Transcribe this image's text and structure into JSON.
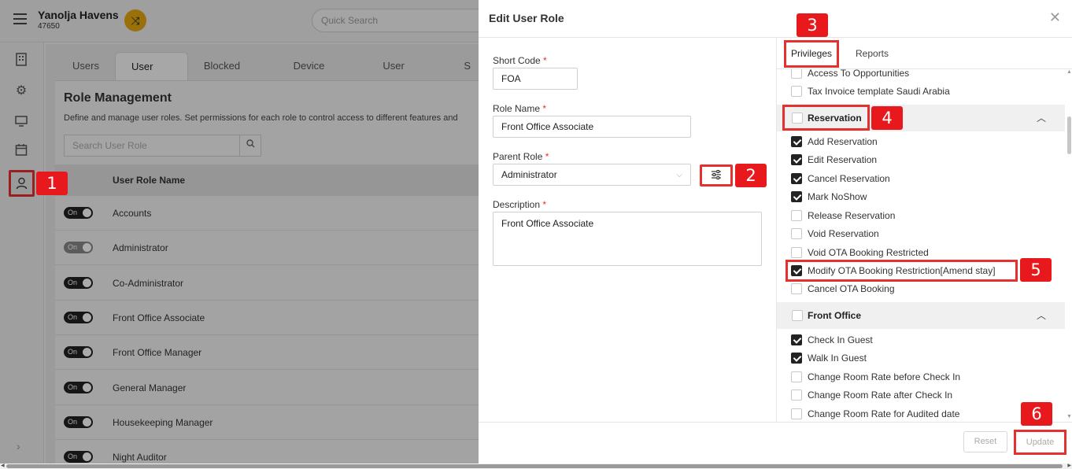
{
  "app": {
    "hotel_name": "Yanolja Havens",
    "hotel_id": "47650",
    "quick_search_placeholder": "Quick Search"
  },
  "tabs": [
    "Users",
    "User Role",
    "Blocked Users",
    "Device Activity",
    "User Activity",
    "S"
  ],
  "role_management": {
    "title": "Role Management",
    "description": "Define and manage user roles. Set permissions for each role to control access to different features and",
    "search_placeholder": "Search User Role",
    "column_header": "User Role Name",
    "rows": [
      {
        "status": "On",
        "name": "Accounts"
      },
      {
        "status": "On",
        "name": "Administrator"
      },
      {
        "status": "On",
        "name": "Co-Administrator"
      },
      {
        "status": "On",
        "name": "Front Office Associate"
      },
      {
        "status": "On",
        "name": "Front Office Manager"
      },
      {
        "status": "On",
        "name": "General Manager"
      },
      {
        "status": "On",
        "name": "Housekeeping Manager"
      },
      {
        "status": "On",
        "name": "Night Auditor"
      }
    ]
  },
  "drawer": {
    "title": "Edit User Role",
    "short_code_label": "Short Code",
    "short_code_value": "FOA",
    "role_name_label": "Role Name",
    "role_name_value": "Front Office Associate",
    "parent_role_label": "Parent Role",
    "parent_role_value": "Administrator",
    "description_label": "Description",
    "description_value": "Front Office Associate",
    "required_mark": "*",
    "tabs": {
      "privileges": "Privileges",
      "reports": "Reports"
    },
    "reset_label": "Reset",
    "update_label": "Update"
  },
  "privileges": {
    "top_items": [
      {
        "label": "Access To Opportunities",
        "checked": false
      },
      {
        "label": "Tax Invoice template Saudi Arabia",
        "checked": false
      }
    ],
    "reservation": {
      "label": "Reservation",
      "items": [
        {
          "label": "Add Reservation",
          "checked": true
        },
        {
          "label": "Edit Reservation",
          "checked": true
        },
        {
          "label": "Cancel Reservation",
          "checked": true
        },
        {
          "label": "Mark NoShow",
          "checked": true
        },
        {
          "label": "Release Reservation",
          "checked": false
        },
        {
          "label": "Void Reservation",
          "checked": false
        },
        {
          "label": "Void OTA Booking Restricted",
          "checked": false
        },
        {
          "label": "Modify OTA Booking Restriction[Amend stay]",
          "checked": true
        },
        {
          "label": "Cancel OTA Booking",
          "checked": false
        }
      ]
    },
    "front_office": {
      "label": "Front Office",
      "items": [
        {
          "label": "Check In Guest",
          "checked": true
        },
        {
          "label": "Walk In Guest",
          "checked": true
        },
        {
          "label": "Change Room Rate before Check In",
          "checked": false
        },
        {
          "label": "Change Room Rate after Check In",
          "checked": false
        },
        {
          "label": "Change Room Rate for Audited date",
          "checked": false
        }
      ]
    }
  },
  "callouts": [
    "1",
    "2",
    "3",
    "4",
    "5",
    "6"
  ],
  "colors": {
    "accent_red": "#e53030",
    "switch_yellow": "#e4a70e"
  }
}
